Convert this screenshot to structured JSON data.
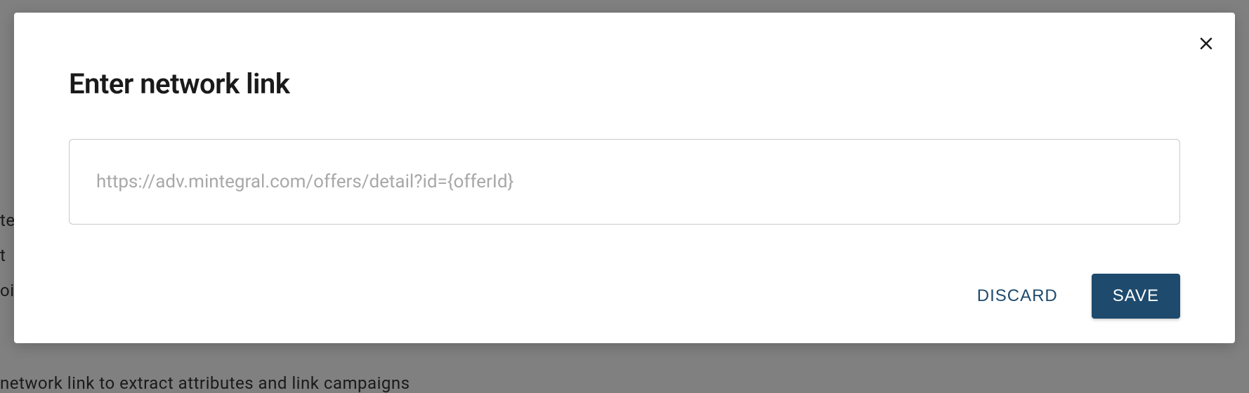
{
  "modal": {
    "title": "Enter network link",
    "input_placeholder": "https://adv.mintegral.com/offers/detail?id={offerId}",
    "input_value": "",
    "discard_label": "DISCARD",
    "save_label": "SAVE"
  },
  "background": {
    "text1": "teg",
    "text2": "t",
    "text3": "oi",
    "text4": "network link to extract attributes and link campaigns"
  }
}
